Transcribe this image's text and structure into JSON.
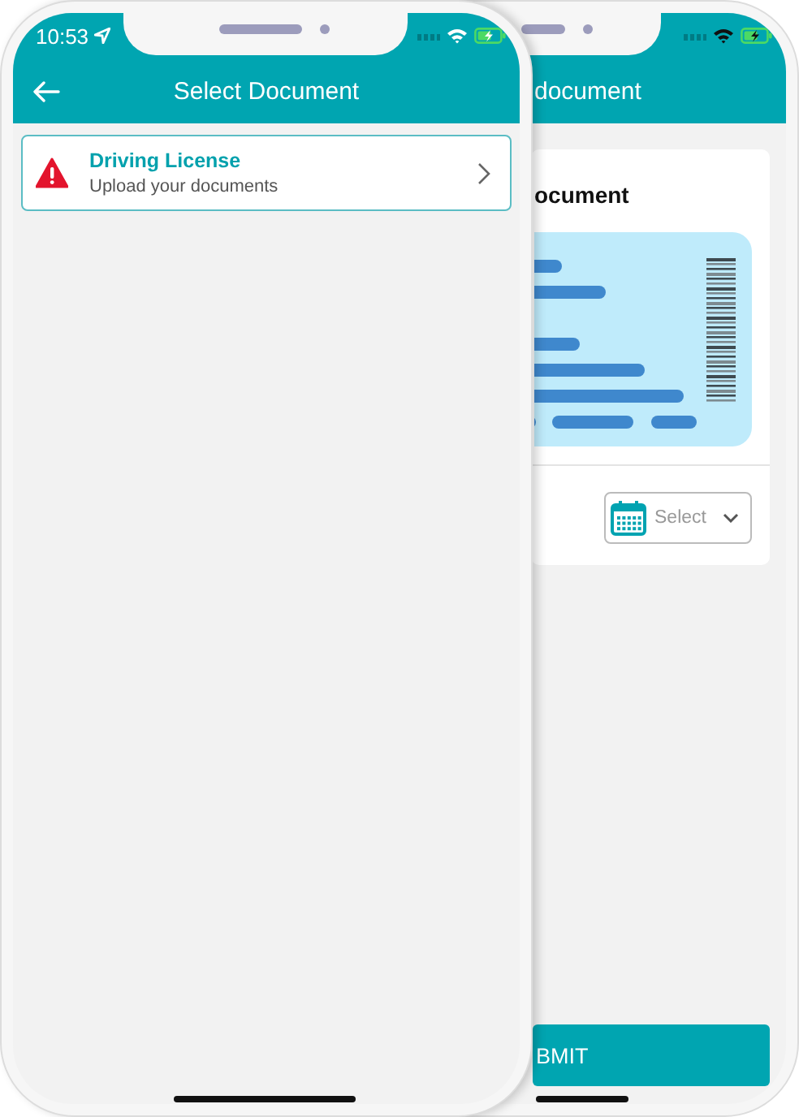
{
  "back_screen": {
    "header": {
      "title": "document"
    },
    "card": {
      "title": "ocument",
      "date_select": {
        "placeholder": "Select"
      }
    },
    "submit_button": {
      "label": "BMIT"
    }
  },
  "front_screen": {
    "status_bar": {
      "time": "10:53"
    },
    "header": {
      "title": "Select Document"
    },
    "documents": [
      {
        "title": "Driving License",
        "subtitle": "Upload your documents",
        "kind": "warning"
      }
    ]
  }
}
